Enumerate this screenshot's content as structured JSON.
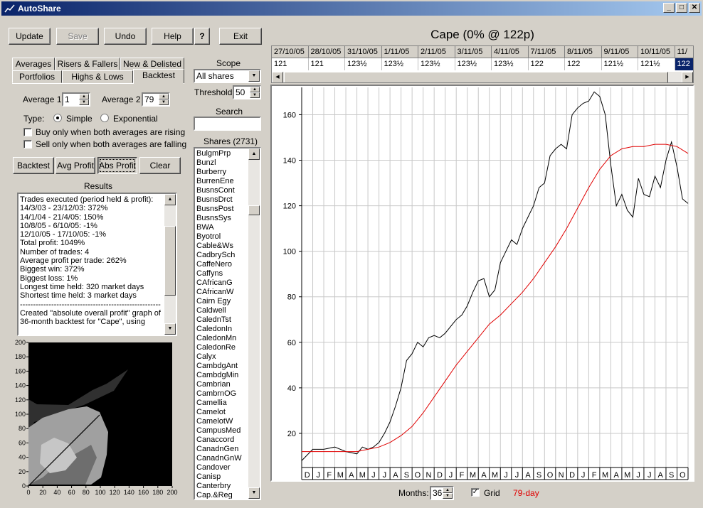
{
  "window": {
    "title": "AutoShare",
    "minimize": "_",
    "maximize": "□",
    "close": "✕"
  },
  "toolbar": {
    "update": "Update",
    "save": "Save",
    "undo": "Undo",
    "help": "Help",
    "help_q": "?",
    "exit": "Exit"
  },
  "tabs": {
    "row1": [
      "Averages",
      "Risers & Fallers",
      "New & Delisted"
    ],
    "row2": [
      "Portfolios",
      "Highs & Lows",
      "Backtest"
    ],
    "active": "Backtest"
  },
  "backtest": {
    "average1_label": "Average 1",
    "average1_value": "1",
    "average2_label": "Average 2",
    "average2_value": "79",
    "type_label": "Type:",
    "simple_label": "Simple",
    "exponential_label": "Exponential",
    "buy_rising_label": "Buy only when both averages are rising",
    "sell_falling_label": "Sell only when both averages are falling",
    "btn_backtest": "Backtest",
    "btn_avg_profit": "Avg Profit",
    "btn_abs_profit": "Abs Profit",
    "btn_clear": "Clear",
    "results_title": "Results",
    "results_lines": [
      "Trades executed (period held & profit):",
      "   14/3/03 - 23/12/03: 372%",
      "   14/1/04 - 21/4/05: 150%",
      "   10/8/05 - 6/10/05: -1%",
      "   12/10/05 - 17/10/05: -1%",
      "Total profit: 1049%",
      "Number of trades: 4",
      "Average profit per trade: 262%",
      "Biggest win: 372%",
      "Biggest loss: 1%",
      "Longest time held: 320 market days",
      "Shortest time held: 3 market days",
      "------------------------------------------------------",
      "Created \"absolute overall profit\" graph of",
      "36-month backtest for \"Cape\", using"
    ]
  },
  "surface": {
    "y_ticks": [
      "200",
      "180",
      "160",
      "140",
      "120",
      "100",
      "80",
      "60",
      "40",
      "20",
      "0"
    ],
    "x_ticks": [
      "0",
      "20",
      "40",
      "60",
      "80",
      "100",
      "120",
      "140",
      "160",
      "180",
      "200"
    ]
  },
  "middle": {
    "scope_label": "Scope",
    "scope_value": "All shares",
    "threshold_label": "Threshold:",
    "threshold_value": "50",
    "search_label": "Search",
    "search_value": "",
    "shares_label": "Shares (2731)",
    "shares": [
      "BulgmPrp",
      "Bunzl",
      "Burberry",
      "BurrenEne",
      "BusnsCont",
      "BusnsDrct",
      "BusnsPost",
      "BusnsSys",
      "BWA",
      "Byotrol",
      "Cable&Ws",
      "CadbrySch",
      "CaffeNero",
      "Caffyns",
      "CAfricanG",
      "CAfricanW",
      "Cairn Egy",
      "Caldwell",
      "CalednTst",
      "CaledonIn",
      "CaledonMn",
      "CaledonRe",
      "Calyx",
      "CambdgAnt",
      "CambdgMin",
      "Cambrian",
      "CambrnOG",
      "Camellia",
      "Camelot",
      "CamelotW",
      "CampusMed",
      "Canaccord",
      "CanadnGen",
      "CanadnGnW",
      "Candover",
      "Canisp",
      "Canterbry",
      "Cap.&Reg"
    ]
  },
  "chart_header": {
    "title": "Cape (0% @ 122p)",
    "dates": [
      "27/10/05",
      "28/10/05",
      "31/10/05",
      "1/11/05",
      "2/11/05",
      "3/11/05",
      "4/11/05",
      "7/11/05",
      "8/11/05",
      "9/11/05",
      "10/11/05",
      "11/"
    ],
    "prices": [
      "121",
      "121",
      "123½",
      "123½",
      "123½",
      "123½",
      "123½",
      "122",
      "122",
      "121½",
      "121½",
      "122"
    ]
  },
  "footer": {
    "months_label": "Months:",
    "months_value": "36",
    "grid_label": "Grid",
    "avg_label": "79-day"
  },
  "colors": {
    "price_line": "#000000",
    "average_line": "#e00000",
    "title_bar": "#0a246a",
    "selected_cell": "#0a246a"
  },
  "chart_data": {
    "type": "line",
    "title": "",
    "xlabel": "",
    "ylabel": "",
    "ylim": [
      5,
      172
    ],
    "y_ticks": [
      20,
      40,
      60,
      80,
      100,
      120,
      140,
      160
    ],
    "x_months": [
      "D",
      "J",
      "F",
      "M",
      "A",
      "M",
      "J",
      "J",
      "A",
      "S",
      "O",
      "N",
      "D",
      "J",
      "F",
      "M",
      "A",
      "M",
      "J",
      "J",
      "A",
      "S",
      "O",
      "N",
      "D",
      "J",
      "F",
      "M",
      "A",
      "M",
      "J",
      "J",
      "A",
      "S",
      "O"
    ],
    "grid": true,
    "series": [
      {
        "name": "",
        "color": "#000000",
        "x": [
          0,
          1,
          2,
          3,
          4,
          5,
          5.5,
          6,
          6.5,
          7,
          7.5,
          8,
          8.5,
          9,
          9.5,
          10,
          10.5,
          11,
          11.5,
          12,
          12.5,
          13,
          13.5,
          14,
          14.5,
          15,
          15.5,
          16,
          16.5,
          17,
          17.5,
          18,
          18.5,
          19,
          19.5,
          20,
          20.5,
          21,
          21.5,
          22,
          22.5,
          23,
          23.5,
          24,
          24.5,
          25,
          25.5,
          26,
          26.5,
          27,
          27.5,
          28,
          28.5,
          29,
          29.5,
          30,
          30.5,
          31,
          31.5,
          32,
          32.5,
          33,
          33.5,
          34,
          34.5,
          35
        ],
        "values": [
          8,
          13,
          13,
          14,
          12,
          11,
          14,
          13,
          14,
          16,
          20,
          25,
          32,
          40,
          52,
          55,
          60,
          58,
          62,
          63,
          62,
          64,
          67,
          70,
          72,
          76,
          82,
          87,
          88,
          80,
          83,
          95,
          100,
          105,
          103,
          110,
          115,
          120,
          128,
          130,
          142,
          145,
          147,
          145,
          160,
          163,
          165,
          166,
          170,
          168,
          160,
          138,
          120,
          125,
          118,
          115,
          132,
          125,
          124,
          133,
          128,
          140,
          148,
          137,
          123,
          121
        ]
      },
      {
        "name": "79-day",
        "color": "#e00000",
        "x": [
          0,
          2,
          4,
          5,
          6,
          7,
          8,
          9,
          10,
          11,
          12,
          13,
          14,
          15,
          16,
          17,
          18,
          19,
          20,
          21,
          22,
          23,
          24,
          25,
          26,
          27,
          28,
          29,
          30,
          31,
          32,
          33,
          34,
          35
        ],
        "values": [
          12,
          12,
          12,
          12,
          13,
          14,
          16,
          19,
          23,
          29,
          36,
          43,
          50,
          56,
          62,
          68,
          72,
          77,
          82,
          88,
          95,
          102,
          110,
          119,
          128,
          136,
          142,
          145,
          146,
          146,
          147,
          147,
          146,
          143
        ]
      }
    ]
  }
}
